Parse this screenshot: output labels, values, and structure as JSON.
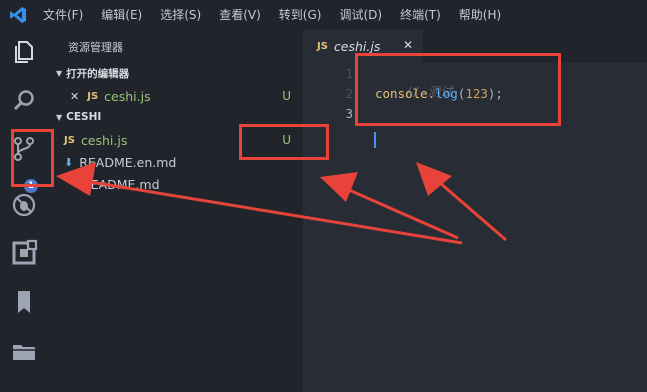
{
  "menubar": {
    "items": [
      "文件(F)",
      "编辑(E)",
      "选择(S)",
      "查看(V)",
      "转到(G)",
      "调试(D)",
      "终端(T)",
      "帮助(H)"
    ]
  },
  "activity_bar": {
    "icons": [
      "files-icon",
      "search-icon",
      "source-control-icon",
      "debug-icon",
      "extensions-icon",
      "bookmark-icon",
      "folder-icon"
    ],
    "scm_badge": "1"
  },
  "sidebar": {
    "title": "资源管理器",
    "open_editors_header": "打开的编辑器",
    "open_editors": [
      {
        "badge": "JS",
        "name": "ceshi.js",
        "status": "U",
        "close": "✕"
      }
    ],
    "folder_header": "CESHI",
    "files": [
      {
        "badge": "JS",
        "name": "ceshi.js",
        "status": "U"
      },
      {
        "badge": "⬇",
        "name": "README.en.md",
        "status": ""
      },
      {
        "badge": "",
        "name": "README.md",
        "status": ""
      }
    ]
  },
  "editor": {
    "tab": {
      "badge": "JS",
      "title": "ceshi.js",
      "close": "✕"
    },
    "line_numbers": [
      "1",
      "2",
      "3"
    ],
    "lines": {
      "comment": "// 测试",
      "l2_obj": "console",
      "l2_dot": ".",
      "l2_fn": "log",
      "l2_open": "(",
      "l2_num": "123",
      "l2_close": ");"
    }
  },
  "colors": {
    "annotation": "#e8433a",
    "status_untracked": "#98c379",
    "js_badge": "#e5c07b",
    "scm_badge": "#4d78cc"
  }
}
